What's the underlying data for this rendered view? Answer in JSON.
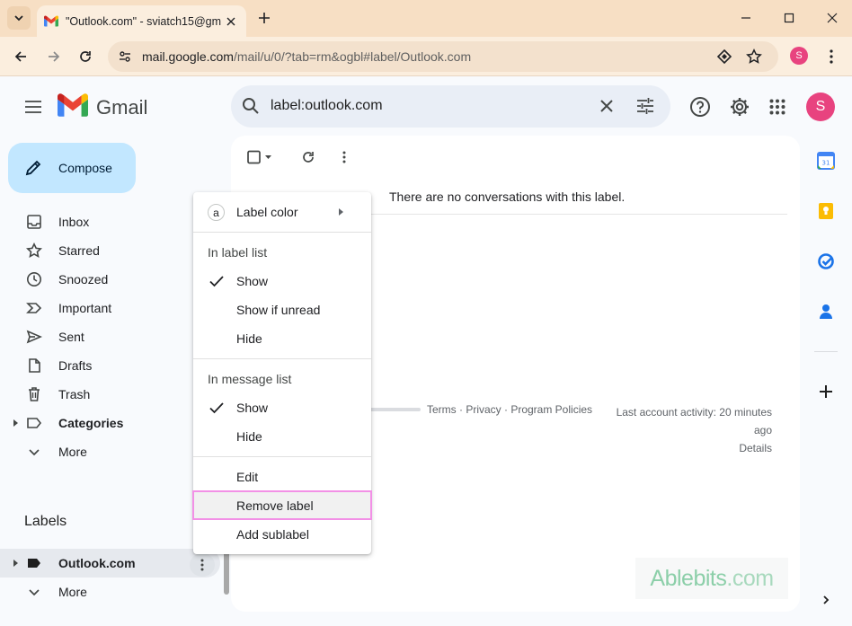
{
  "browser": {
    "tab_title": "\"Outlook.com\" - sviatch15@gm",
    "url_host": "mail.google.com",
    "url_path": "/mail/u/0/?tab=rm&ogbl#label/Outlook.com",
    "profile_initial": "S"
  },
  "header": {
    "product_name": "Gmail",
    "search_query": "label:outlook.com",
    "avatar_initial": "S"
  },
  "sidebar": {
    "compose_label": "Compose",
    "items": [
      {
        "label": "Inbox",
        "icon": "inbox-icon"
      },
      {
        "label": "Starred",
        "icon": "star-icon"
      },
      {
        "label": "Snoozed",
        "icon": "clock-icon"
      },
      {
        "label": "Important",
        "icon": "important-icon"
      },
      {
        "label": "Sent",
        "icon": "send-icon"
      },
      {
        "label": "Drafts",
        "icon": "draft-icon"
      },
      {
        "label": "Trash",
        "icon": "trash-icon"
      },
      {
        "label": "Categories",
        "icon": "label-icon"
      },
      {
        "label": "More",
        "icon": "chevron-down-icon"
      }
    ],
    "labels_heading": "Labels",
    "labels": [
      {
        "label": "Outlook.com"
      }
    ],
    "labels_more": "More"
  },
  "main": {
    "empty_message": "There are no conversations with this label.",
    "footer_links": "Terms · Privacy · Program Policies",
    "activity_line1": "Last account activity: 20 minutes",
    "activity_line2": "ago",
    "activity_details": "Details",
    "watermark_part1": "Ablebits",
    "watermark_part2": ".com"
  },
  "context_menu": {
    "label_color_icon_letter": "a",
    "label_color": "Label color",
    "section_label_list": "In label list",
    "label_list_show": "Show",
    "label_list_show_if_unread": "Show if unread",
    "label_list_hide": "Hide",
    "section_message_list": "In message list",
    "message_list_show": "Show",
    "message_list_hide": "Hide",
    "edit": "Edit",
    "remove_label": "Remove label",
    "add_sublabel": "Add sublabel"
  },
  "colors": {
    "compose_bg": "#c2e7ff",
    "avatar": "#e8437f",
    "highlight_border": "#f290e6",
    "titlebar": "#f7dfc4"
  }
}
